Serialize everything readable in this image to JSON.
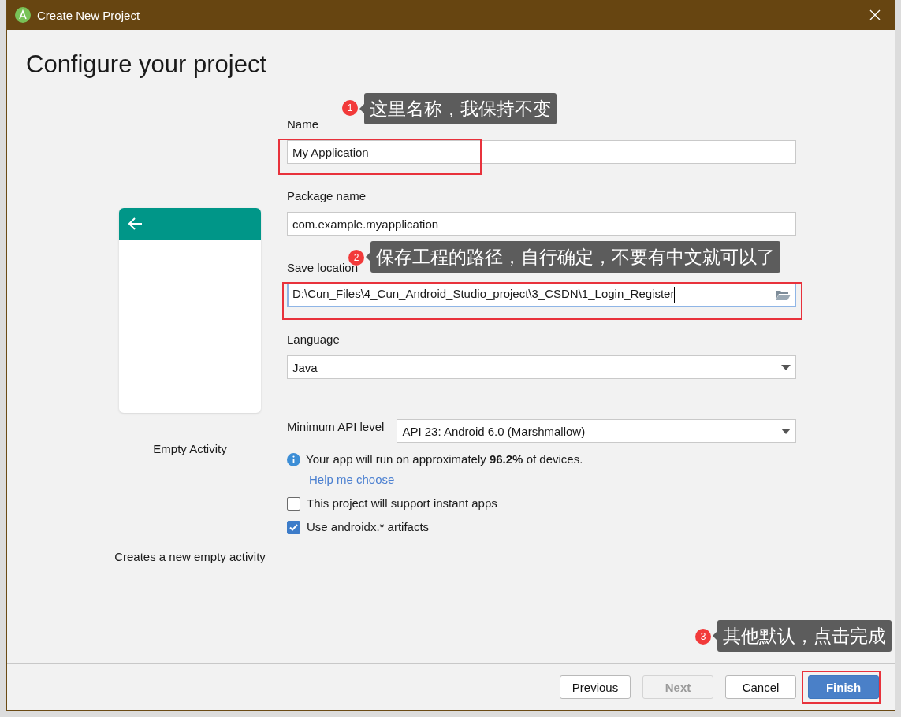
{
  "window": {
    "title": "Create New Project"
  },
  "heading": "Configure your project",
  "template": {
    "name": "Empty Activity",
    "description": "Creates a new empty activity"
  },
  "fields": [
    {
      "kind": "text",
      "label": "Name",
      "value": "My Application",
      "focused": false
    },
    {
      "kind": "text",
      "label": "Package name",
      "value": "com.example.myapplication",
      "focused": false
    },
    {
      "kind": "path",
      "label": "Save location",
      "value": "D:\\Cun_Files\\4_Cun_Android_Studio_project\\3_CSDN\\1_Login_Register",
      "focused": true
    },
    {
      "kind": "select",
      "label": "Language",
      "value": "Java",
      "focused": false
    }
  ],
  "min_api": {
    "label": "Minimum API level",
    "value": "API 23: Android 6.0 (Marshmallow)"
  },
  "info": "Your app will run on approximately **96.2%** of devices.",
  "help_link": "Help me choose",
  "checkboxes": [
    {
      "label": "This project will support instant apps",
      "checked": false
    },
    {
      "label": "Use androidx.* artifacts",
      "checked": true
    }
  ],
  "buttons": [
    {
      "label": "Previous",
      "kind": "default",
      "disabled": false
    },
    {
      "label": "Next",
      "kind": "default",
      "disabled": true
    },
    {
      "label": "Cancel",
      "kind": "default",
      "disabled": false
    },
    {
      "label": "Finish",
      "kind": "primary",
      "disabled": false
    }
  ],
  "annotations": [
    {
      "number": "1",
      "text": "这里名称，我保持不变"
    },
    {
      "number": "2",
      "text": "保存工程的路径，自行确定，不要有中文就可以了"
    },
    {
      "number": "3",
      "text": "其他默认，点击完成"
    }
  ]
}
